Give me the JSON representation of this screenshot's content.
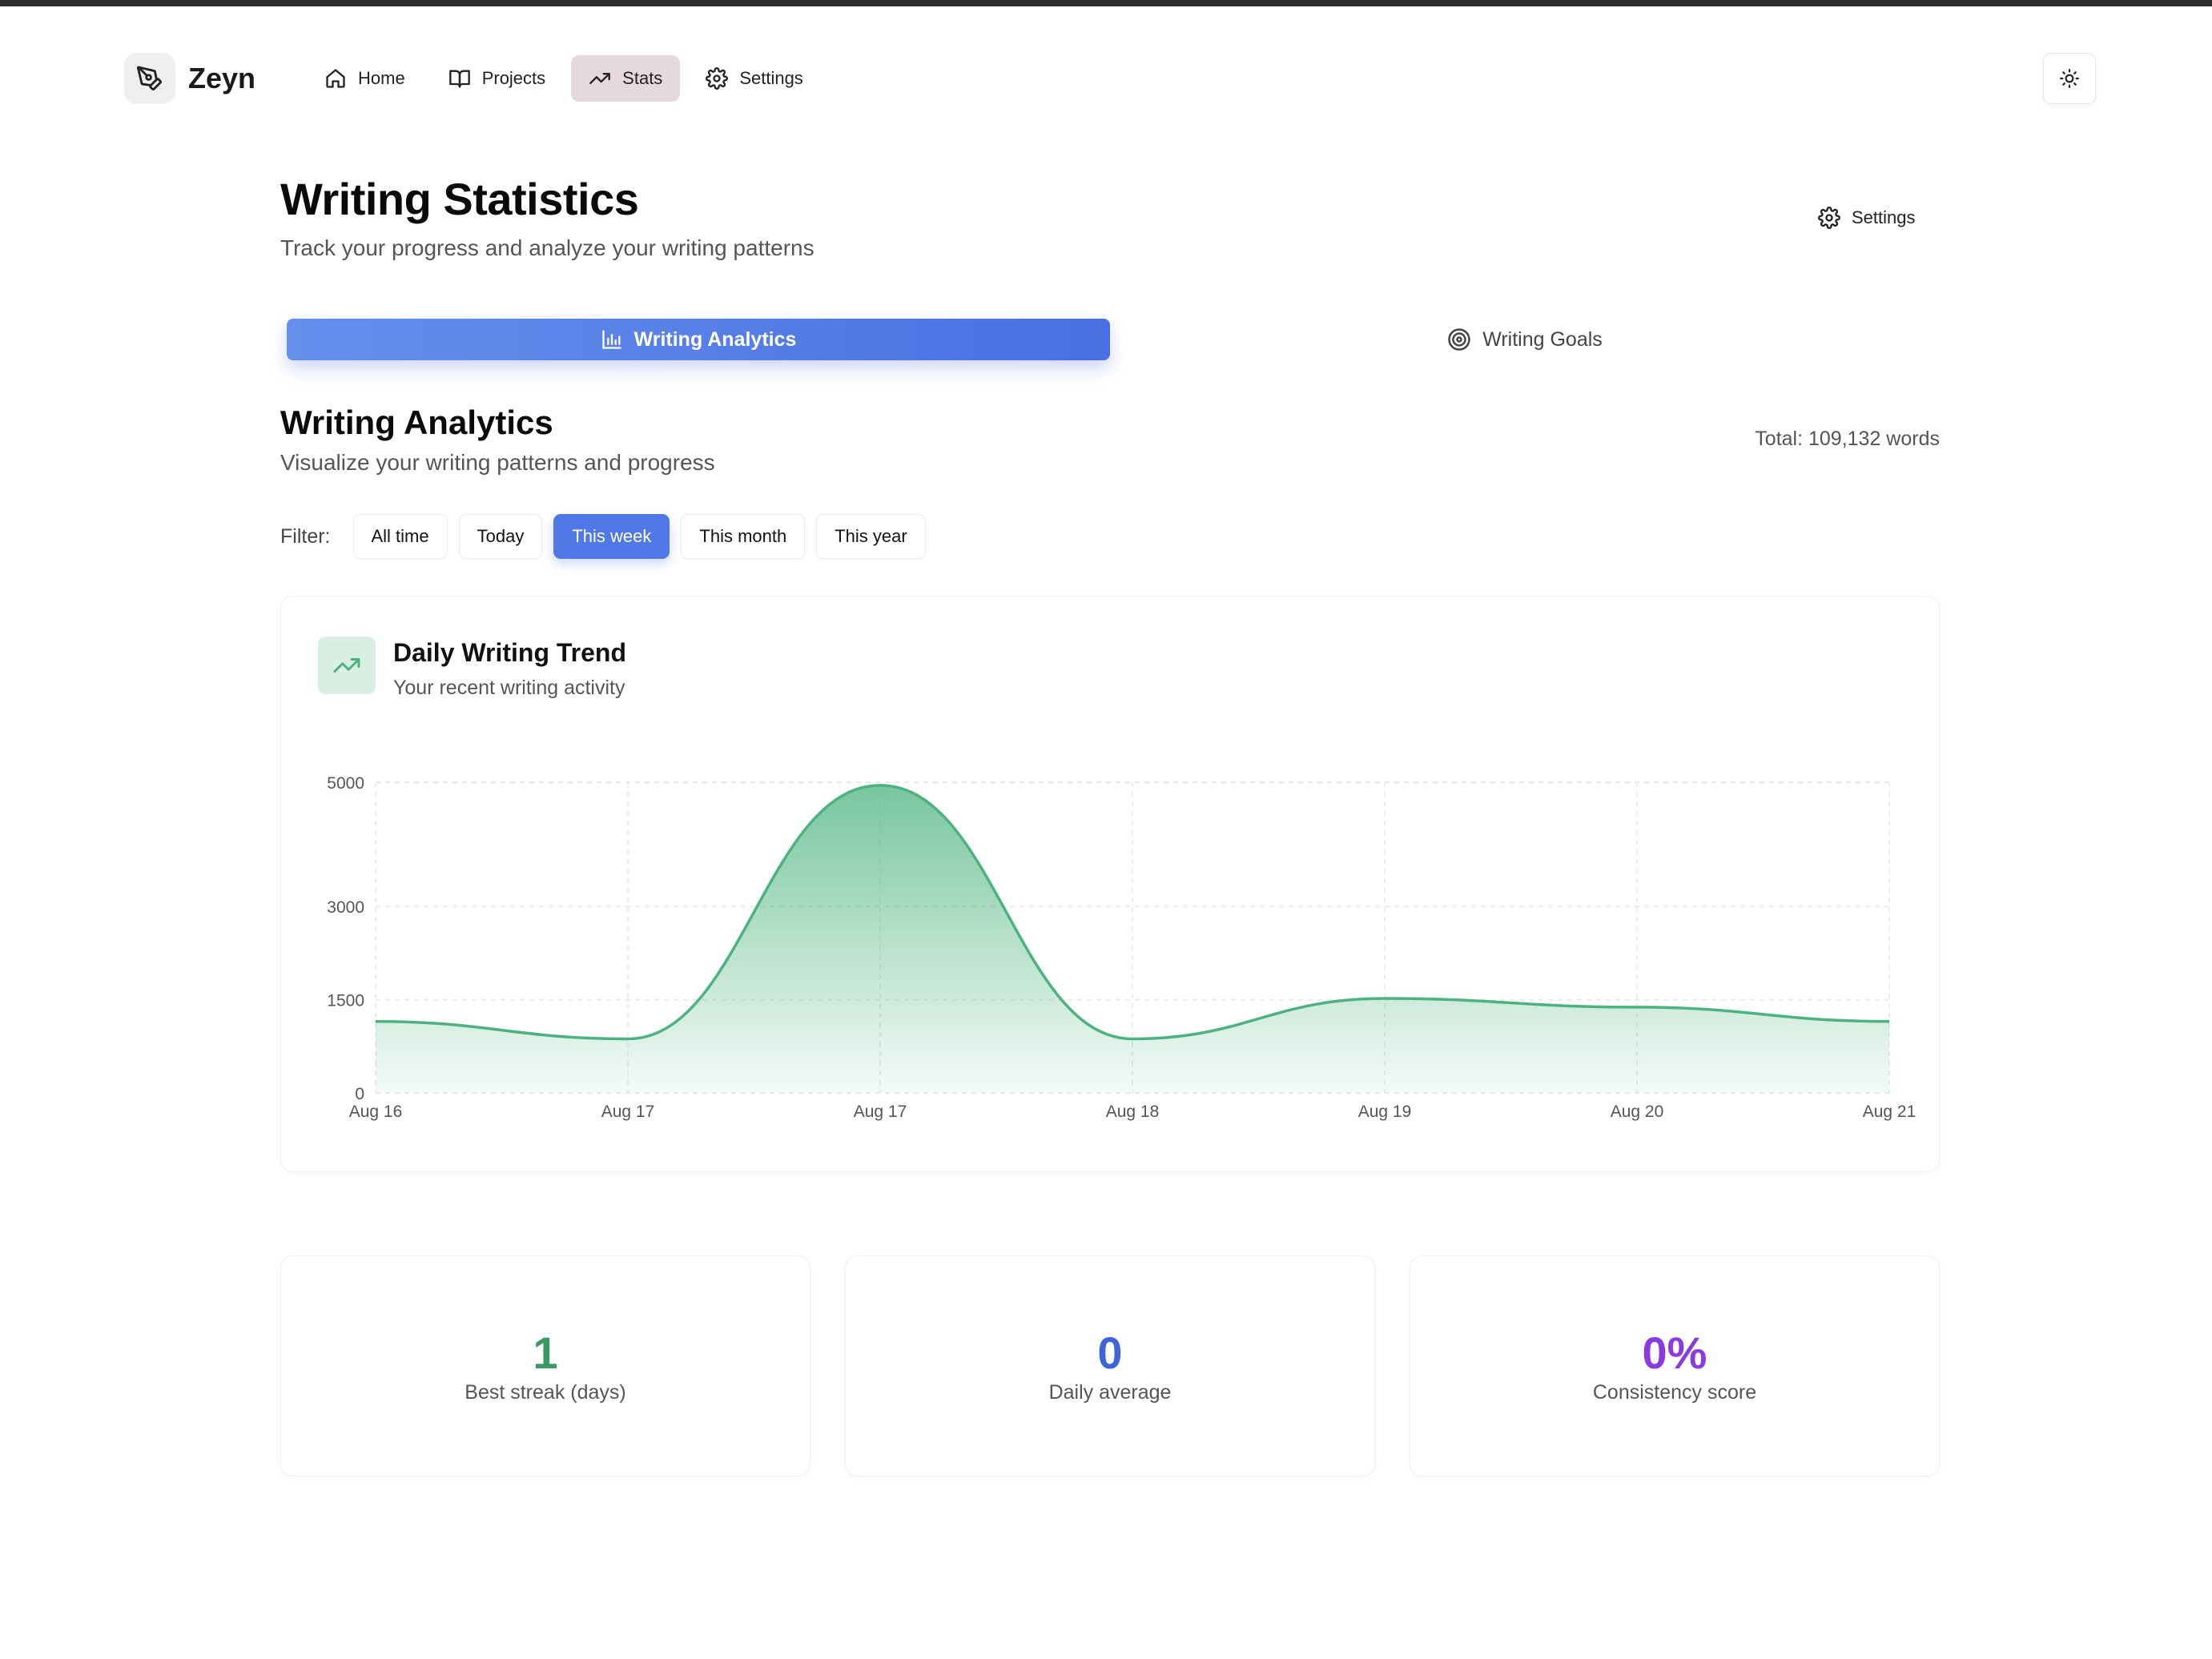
{
  "app": {
    "name": "Zeyn"
  },
  "nav": {
    "items": [
      {
        "label": "Home",
        "icon": "home-icon"
      },
      {
        "label": "Projects",
        "icon": "book-icon"
      },
      {
        "label": "Stats",
        "icon": "trending-up-icon",
        "active": true
      },
      {
        "label": "Settings",
        "icon": "gear-icon"
      }
    ],
    "theme_toggle_icon": "sun-icon"
  },
  "page": {
    "title": "Writing Statistics",
    "subtitle": "Track your progress and analyze your writing patterns",
    "settings_label": "Settings"
  },
  "tabs": [
    {
      "label": "Writing Analytics",
      "icon": "bar-chart-icon",
      "active": true
    },
    {
      "label": "Writing Goals",
      "icon": "target-icon",
      "active": false
    }
  ],
  "analytics": {
    "title": "Writing Analytics",
    "subtitle": "Visualize your writing patterns and progress",
    "total": "Total: 109,132 words",
    "filter_label": "Filter:",
    "filters": [
      {
        "label": "All time",
        "active": false
      },
      {
        "label": "Today",
        "active": false
      },
      {
        "label": "This week",
        "active": true
      },
      {
        "label": "This month",
        "active": false
      },
      {
        "label": "This year",
        "active": false
      }
    ]
  },
  "trend_card": {
    "title": "Daily Writing Trend",
    "subtitle": "Your recent writing activity"
  },
  "chart_data": {
    "type": "area",
    "x": [
      "Aug 16",
      "Aug 17",
      "Aug 17",
      "Aug 18",
      "Aug 19",
      "Aug 20",
      "Aug 21"
    ],
    "values": [
      1150,
      870,
      4950,
      870,
      1520,
      1380,
      1150
    ],
    "y_ticks": [
      0,
      1500,
      3000,
      5000
    ],
    "ylim": [
      0,
      5000
    ],
    "grid": true,
    "color": "#4bb37e"
  },
  "stats": [
    {
      "value": "1",
      "label": "Best streak (days)",
      "color": "#3a9a66"
    },
    {
      "value": "0",
      "label": "Daily average",
      "color": "#3d63dd"
    },
    {
      "value": "0%",
      "label": "Consistency score",
      "color": "#8a3be0"
    }
  ]
}
